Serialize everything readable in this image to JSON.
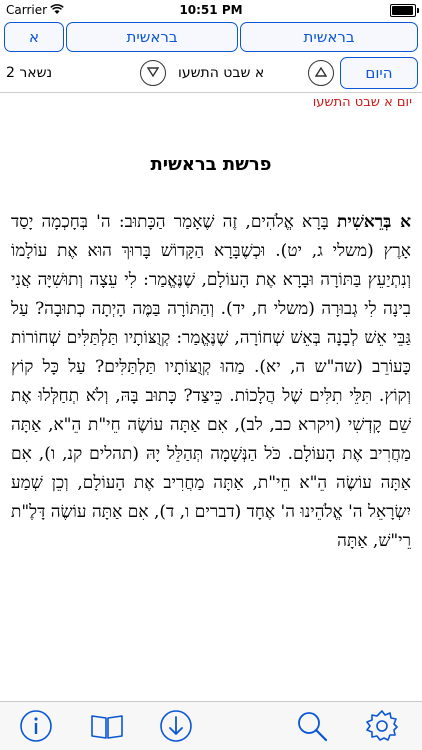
{
  "status": {
    "carrier": "Carrier",
    "time": "10:51 PM"
  },
  "header": {
    "chapter_button": "א",
    "parsha_button_left": "בראשית",
    "parsha_button_right": "בראשית"
  },
  "date_nav": {
    "remaining": "נשאר 2",
    "date": "א שבט התשעו",
    "today_button": "היום"
  },
  "day_line": "יום א שבט התשעו",
  "title": "פרשת בראשית",
  "content": {
    "lead": "א בְּרֵאשִׁית",
    "text": " בָּרָא אֱלֹהִים, זֶה שֶׁאָמַר הַכָּתוּב: ה' בְּחָכְמָה יָסַד אָרֶץ (משלי ג, יט). וּכְשֶׁבָּרָא הַקָּדוֹשׁ בָּרוּךְ הוּא אֶת עוֹלָמוֹ וְנִתְיַעֵץ בַּתּוֹרָה וּבָרָא אֶת הָעוֹלָם, שֶׁנֶּאֱמַר: לִי עֵצָה וְתוּשִׁיָּה אֲנִי בִינָה לִי גְבוּרָה (משלי ח, יד). וְהַתּוֹרָה בַּמֶּה הָיְתָה כְתוּבָה? עַל גַּבֵּי אֵשׁ לְבָנָה בְּאֵשׁ שְׁחוֹרָה, שֶׁנֶּאֱמַר: קְוֻצּוֹתָיו תַּלְתַּלִּים שְׁחוֹרוֹת כָּעוֹרֵב (שה\"ש ה, יא). מַהוּ קְוֻצּוֹתָיו תַּלְתַּלִּים? עַל כָּל קוֹץ וְקוֹץ. תִּלֵּי תִלִּים שֶׁל הֲלָכוֹת. כֵּיצַד? כָּתוּב בָּהּ, וְלֹא תְחַלְּלוּ אֶת שֵׁם קָדְשִׁי (ויקרא כב, לב), אִם אַתָּה עוֹשֶׂה חֵי\"ת הֵ\"א, אַתָּה מַחֲרִיב אֶת הָעוֹלָם. כֹּל הַנְּשָׁמָה תְּהַלֵּל יָהּ (תהלים קנ, ו), אִם אַתָּה עוֹשֶׂה הֵ\"א חֵי\"ת, אַתָּה מַחֲרִיב אֶת הָעוֹלָם, וְכֵן שְׁמַע יִשְׂרָאֵל ה' אֱלֹהֵינוּ ה' אֶחָד (דברים ו, ד), אִם אַתָּה עוֹשֶׂה דָּלֶ\"ת רֵי\"שׁ, אַתָּה"
  },
  "toolbar": {
    "icons": [
      "info-icon",
      "book-icon",
      "download-icon",
      "search-icon",
      "gear-icon"
    ]
  },
  "colors": {
    "accent": "#0a56d6",
    "red": "#d01818"
  }
}
